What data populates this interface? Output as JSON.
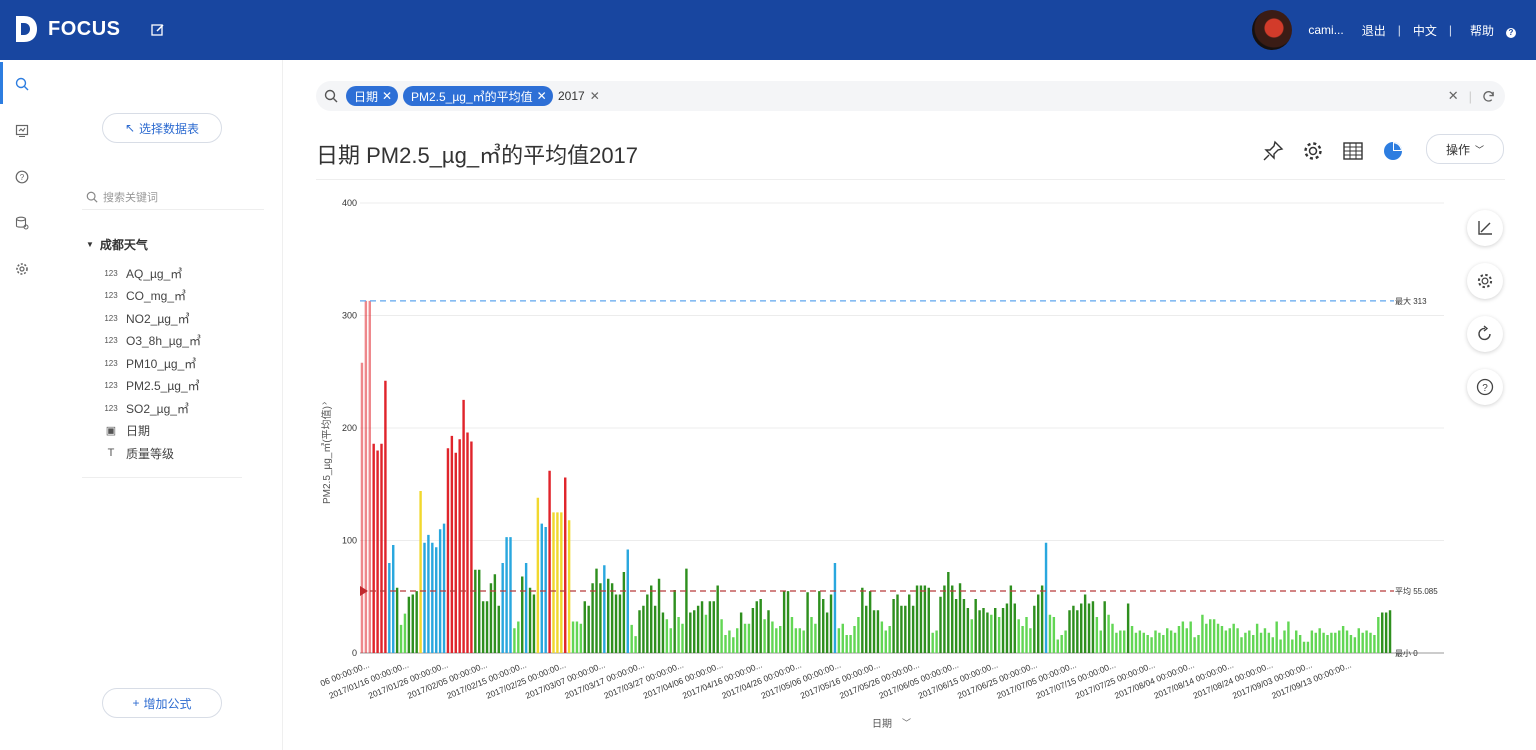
{
  "app": {
    "logo_text": "FOCUS",
    "user_name": "cami...",
    "logout": "退出",
    "language": "中文",
    "help": "帮助"
  },
  "left_panel": {
    "select_table_label": "选择数据表",
    "search_placeholder": "搜索关键词",
    "table_name": "成都天气",
    "fields": [
      {
        "icon": "123",
        "name": "AQ_µg_㎥"
      },
      {
        "icon": "123",
        "name": "CO_mg_㎥"
      },
      {
        "icon": "123",
        "name": "NO2_µg_㎥"
      },
      {
        "icon": "123",
        "name": "O3_8h_µg_㎥"
      },
      {
        "icon": "123",
        "name": "PM10_µg_㎥"
      },
      {
        "icon": "123",
        "name": "PM2.5_µg_㎥"
      },
      {
        "icon": "123",
        "name": "SO2_µg_㎥"
      },
      {
        "icon": "date",
        "name": "日期"
      },
      {
        "icon": "text",
        "name": "质量等级"
      }
    ],
    "add_formula_label": "增加公式"
  },
  "search": {
    "chips": [
      "日期",
      "PM2.5_µg_㎥的平均值"
    ],
    "plain_token": "2017"
  },
  "main": {
    "title": "日期 PM2.5_µg_㎥的平均值2017",
    "operation_label": "操作"
  },
  "colors": {
    "red": "#e0242b",
    "yellow": "#f1d82e",
    "blue": "#29a7de",
    "dark_green": "#2e8f1e",
    "light_green": "#62d654",
    "max_line": "#5fa6ee",
    "avg_line": "#b83b3b"
  },
  "chart_data": {
    "type": "bar",
    "x_label": "日期",
    "y_label": "PM2.5_µg_㎥(平均值)",
    "ylim": [
      0,
      400
    ],
    "y_ticks": [
      "0",
      "100",
      "200",
      "300",
      "400"
    ],
    "x_ticks": [
      "06 00:00:00...",
      "2017/01/16 00:00:00...",
      "2017/01/26 00:00:00...",
      "2017/02/05 00:00:00...",
      "2017/02/15 00:00:00...",
      "2017/02/25 00:00:00...",
      "2017/03/07 00:00:00...",
      "2017/03/17 00:00:00...",
      "2017/03/27 00:00:00...",
      "2017/04/06 00:00:00...",
      "2017/04/16 00:00:00...",
      "2017/04/26 00:00:00...",
      "2017/05/06 00:00:00...",
      "2017/05/16 00:00:00...",
      "2017/05/26 00:00:00...",
      "2017/06/05 00:00:00...",
      "2017/06/15 00:00:00...",
      "2017/06/25 00:00:00...",
      "2017/07/05 00:00:00...",
      "2017/07/15 00:00:00...",
      "2017/07/25 00:00:00...",
      "2017/08/04 00:00:00...",
      "2017/08/14 00:00:00...",
      "2017/08/24 00:00:00...",
      "2017/09/03 00:00:00...",
      "2017/09/13 00:00:00..."
    ],
    "max_label": "最大 313",
    "avg_label": "平均 55.085",
    "min_label": "最小 0",
    "max": 313,
    "avg": 55.085,
    "min": 0,
    "values": [
      258,
      313,
      313,
      186,
      180,
      186,
      242,
      80,
      96,
      58,
      25,
      35,
      50,
      52,
      55,
      144,
      98,
      105,
      98,
      94,
      110,
      115,
      182,
      193,
      178,
      190,
      225,
      196,
      188,
      74,
      74,
      46,
      46,
      62,
      70,
      42,
      80,
      103,
      103,
      22,
      28,
      68,
      80,
      58,
      52,
      138,
      115,
      112,
      162,
      125,
      125,
      125,
      156,
      118,
      28,
      28,
      26,
      46,
      42,
      62,
      75,
      62,
      78,
      66,
      62,
      52,
      52,
      72,
      92,
      25,
      15,
      38,
      42,
      52,
      60,
      42,
      66,
      36,
      30,
      22,
      56,
      32,
      26,
      75,
      36,
      38,
      42,
      46,
      34,
      46,
      46,
      60,
      30,
      16,
      20,
      14,
      22,
      36,
      26,
      26,
      40,
      46,
      48,
      30,
      38,
      28,
      22,
      24,
      55,
      55,
      32,
      22,
      22,
      20,
      54,
      32,
      26,
      55,
      48,
      36,
      52,
      80,
      22,
      26,
      16,
      16,
      24,
      32,
      58,
      42,
      55,
      38,
      38,
      28,
      20,
      24,
      48,
      52,
      42,
      42,
      52,
      42,
      60,
      60,
      60,
      58,
      18,
      20,
      50,
      60,
      72,
      60,
      48,
      62,
      48,
      40,
      30,
      48,
      38,
      40,
      36,
      34,
      40,
      32,
      40,
      44,
      60,
      44,
      30,
      24,
      32,
      22,
      42,
      52,
      60,
      98,
      34,
      32,
      12,
      16,
      20,
      38,
      42,
      38,
      44,
      52,
      44,
      46,
      32,
      20,
      46,
      34,
      26,
      18,
      20,
      20,
      44,
      24,
      18,
      20,
      18,
      16,
      14,
      20,
      18,
      16,
      22,
      20,
      18,
      24,
      28,
      22,
      28,
      14,
      16,
      34,
      26,
      30,
      30,
      26,
      24,
      20,
      22,
      26,
      22,
      14,
      18,
      20,
      16,
      26,
      18,
      22,
      18,
      14,
      28,
      12,
      20,
      28,
      12,
      20,
      16,
      10,
      10,
      20,
      18,
      22,
      18,
      16,
      18,
      18,
      20,
      24,
      20,
      16,
      14,
      22,
      18,
      20,
      18,
      16,
      32,
      36,
      36,
      38
    ]
  }
}
